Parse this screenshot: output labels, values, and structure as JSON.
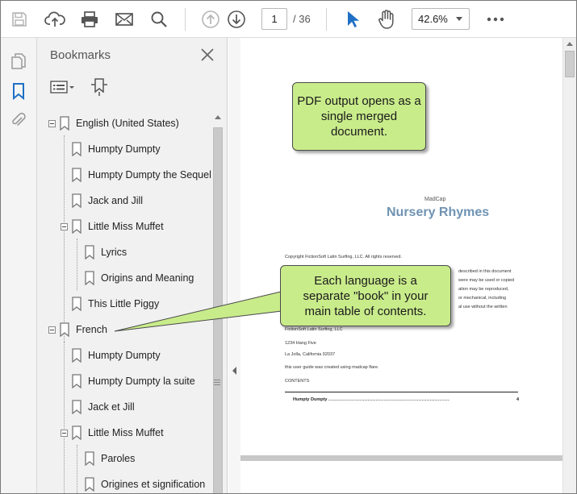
{
  "toolbar": {
    "icons": [
      "save-icon",
      "cloud-upload-icon",
      "print-icon",
      "email-icon",
      "search-icon",
      "page-up-icon",
      "page-down-icon",
      "select-cursor-icon",
      "hand-tool-icon",
      "more-icon"
    ],
    "current_page": "1",
    "page_total": "/ 36",
    "zoom": "42.6%"
  },
  "rail": {
    "icons": [
      "pages-icon",
      "bookmark-icon",
      "attachment-icon"
    ]
  },
  "bookmarks": {
    "title": "Bookmarks",
    "items": [
      {
        "label": "English (United States)"
      },
      {
        "label": "Humpty Dumpty"
      },
      {
        "label": "Humpty Dumpty the Sequel"
      },
      {
        "label": "Jack and Jill"
      },
      {
        "label": "Little Miss Muffet"
      },
      {
        "label": "Lyrics"
      },
      {
        "label": "Origins and Meaning"
      },
      {
        "label": "This Little Piggy"
      },
      {
        "label": "French"
      },
      {
        "label": "Humpty Dumpty"
      },
      {
        "label": "Humpty Dumpty la suite"
      },
      {
        "label": "Jack et Jill"
      },
      {
        "label": "Little Miss Muffet"
      },
      {
        "label": "Paroles"
      },
      {
        "label": "Origines et signification"
      }
    ]
  },
  "document": {
    "brand": "MadCap",
    "title": "Nursery Rhymes",
    "copyright": "Copyright FictionSoft Latin Surfing, LLC. All rights reserved.",
    "right_fragments": [
      "described in this document",
      "were may be used or copied",
      "ation may be reproduced,",
      "or mechanical, including",
      "al use without the written"
    ],
    "company": "FictionSoft Latin Surfing, LLC",
    "address1": "1234 Hang Five",
    "address2": "La Jolla, California 92037",
    "created": "this user guide was created using madcap flare.",
    "contents_heading": "CONTENTS",
    "toc_entry": "Humpty Dumpty",
    "toc_page": "4"
  },
  "callouts": {
    "top": "PDF output opens as a single merged document.",
    "bottom": "Each language is a separate \"book\" in your main table of contents."
  },
  "colors": {
    "accent_blue": "#1f6fc5",
    "callout_green": "#c9ec8b",
    "doc_title": "#6f93b3"
  }
}
